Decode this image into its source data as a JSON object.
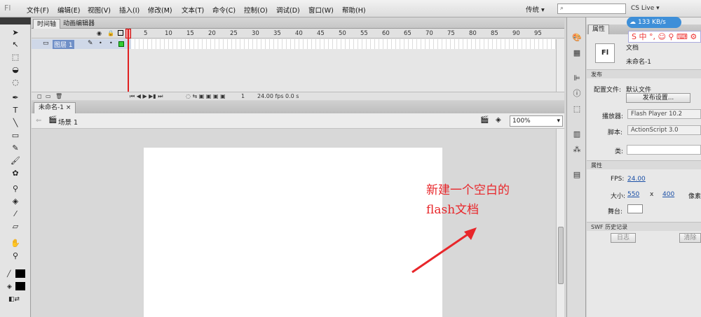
{
  "app": {
    "logo": "Fl"
  },
  "menu": [
    "文件(F)",
    "编辑(E)",
    "视图(V)",
    "插入(I)",
    "修改(M)",
    "文本(T)",
    "命令(C)",
    "控制(O)",
    "调试(D)",
    "窗口(W)",
    "帮助(H)"
  ],
  "top_right": {
    "workspace": "传统 ▾",
    "search_icon": "⌕",
    "cs_live": "CS Live ▾",
    "speed": "133 KB/s",
    "ime": "S 中 °, ☺ ⚲ ⌨ ⚙"
  },
  "timeline": {
    "tabs": [
      "时间轴",
      "动画编辑器"
    ],
    "frame_numbers": [
      "1",
      "5",
      "10",
      "15",
      "20",
      "25",
      "30",
      "35",
      "40",
      "45",
      "50",
      "55",
      "60",
      "65",
      "70",
      "75",
      "80",
      "85",
      "90",
      "95"
    ],
    "layer_name": "图层 1",
    "footer": {
      "frame": "1",
      "fps": "24.00 fps",
      "time": "0.0 s"
    }
  },
  "document": {
    "tab": "未命名-1 ×",
    "scene": "场景 1",
    "zoom": "100%"
  },
  "annotation": {
    "line1": "新建一个空白的",
    "line2": "flash文档"
  },
  "properties": {
    "tab": "属性",
    "doc_type": "文档",
    "doc_name": "未命名-1",
    "publish_section": "发布",
    "profile_label": "配置文件:",
    "profile_value": "默认文件",
    "publish_settings": "发布设置...",
    "player_label": "播放器:",
    "player_value": "Flash Player 10.2",
    "script_label": "脚本:",
    "script_value": "ActionScript 3.0",
    "class_label": "类:",
    "props_section": "属性",
    "fps_label": "FPS:",
    "fps_value": "24.00",
    "size_label": "大小:",
    "width": "550",
    "x": "x",
    "height": "400",
    "unit": "像素",
    "stage_label": "舞台:",
    "swf_section": "SWF 历史记录",
    "log_button": "日志",
    "clear_button": "清除"
  },
  "colors": {
    "stage": "#ffffff",
    "pasteboard": "#d8d8d8",
    "annotation": "#e8262a",
    "layer_selected": "#6f8fc7"
  }
}
